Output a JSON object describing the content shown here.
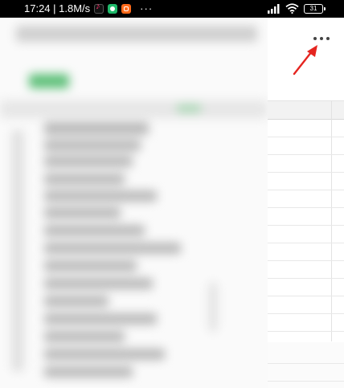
{
  "status_bar": {
    "time_speed": "17:24 | 1.8M/s",
    "notification_apps": [
      "tiktok-icon",
      "shield-app-icon",
      "orange-app-icon"
    ],
    "more": "···",
    "battery_level": "31"
  },
  "toolbar": {
    "more_icon": "more-horizontal-icon"
  },
  "annotation": {
    "color": "#e52520"
  },
  "colors": {
    "accent_green": "#5fc07a"
  }
}
